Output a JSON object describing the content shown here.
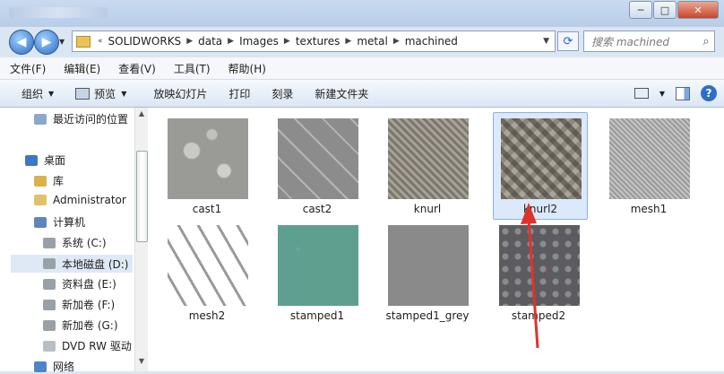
{
  "window": {
    "buttons": {
      "minimize": "─",
      "maximize": "□",
      "close": "✕"
    }
  },
  "address": {
    "overflow": "«",
    "crumbs": [
      "SOLIDWORKS",
      "data",
      "Images",
      "textures",
      "metal",
      "machined"
    ],
    "refresh_icon": "refresh-icon",
    "search_placeholder": "搜索 machined"
  },
  "menu": [
    "文件(F)",
    "编辑(E)",
    "查看(V)",
    "工具(T)",
    "帮助(H)"
  ],
  "toolbar": {
    "organize": "组织",
    "preview": "预览",
    "slideshow": "放映幻灯片",
    "print": "打印",
    "burn": "刻录",
    "new_folder": "新建文件夹"
  },
  "sidebar": {
    "items": [
      {
        "label": "最近访问的位置",
        "icon": "recent-places-icon"
      },
      {
        "label": "桌面",
        "icon": "desktop-icon"
      },
      {
        "label": "库",
        "icon": "library-icon"
      },
      {
        "label": "Administrator",
        "icon": "user-folder-icon"
      },
      {
        "label": "计算机",
        "icon": "computer-icon"
      },
      {
        "label": "系统 (C:)",
        "icon": "drive-icon"
      },
      {
        "label": "本地磁盘 (D:)",
        "icon": "drive-icon",
        "selected": true
      },
      {
        "label": "资料盘 (E:)",
        "icon": "drive-icon"
      },
      {
        "label": "新加卷 (F:)",
        "icon": "drive-icon"
      },
      {
        "label": "新加卷 (G:)",
        "icon": "drive-icon"
      },
      {
        "label": "DVD RW 驱动",
        "icon": "dvd-drive-icon"
      },
      {
        "label": "网络",
        "icon": "network-icon"
      }
    ]
  },
  "files": [
    {
      "name": "cast1"
    },
    {
      "name": "cast2"
    },
    {
      "name": "knurl"
    },
    {
      "name": "knurl2",
      "selected": true
    },
    {
      "name": "mesh1"
    },
    {
      "name": "mesh2"
    },
    {
      "name": "stamped1"
    },
    {
      "name": "stamped1_grey"
    },
    {
      "name": "stamped2"
    }
  ],
  "colors": {
    "arrow": "#e0322a",
    "selection": "#dbe9fb"
  }
}
